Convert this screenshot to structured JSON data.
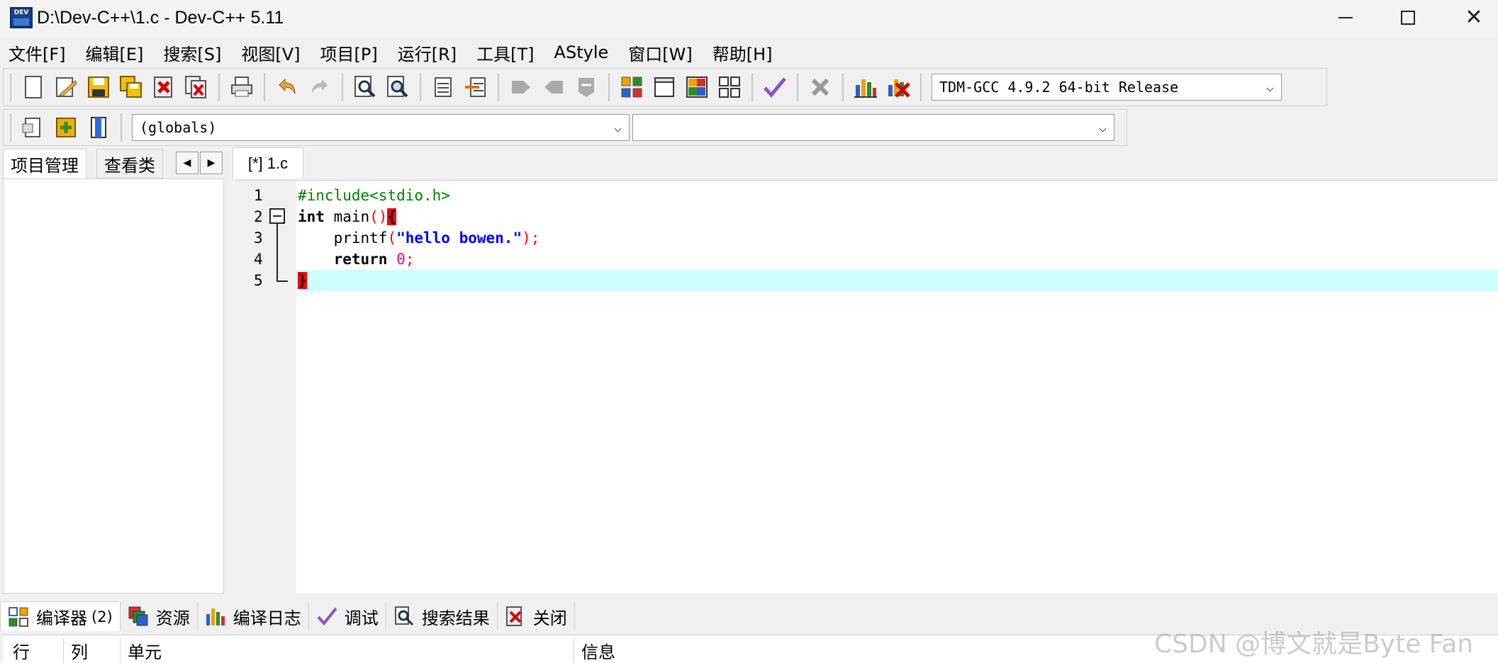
{
  "window": {
    "title": "D:\\Dev-C++\\1.c - Dev-C++ 5.11",
    "icon_label": "DEV",
    "minimize_glyph": "—",
    "close_glyph": "✕"
  },
  "menu": [
    "文件[F]",
    "编辑[E]",
    "搜索[S]",
    "视图[V]",
    "项目[P]",
    "运行[R]",
    "工具[T]",
    "AStyle",
    "窗口[W]",
    "帮助[H]"
  ],
  "toolbar": {
    "compiler_select": "TDM-GCC 4.9.2 64-bit Release",
    "scope_select": "(globals)",
    "symbol_select": ""
  },
  "left_panel": {
    "tabs": [
      "项目管理",
      "查看类"
    ],
    "scroll_left": "◀",
    "scroll_right": "▶"
  },
  "editor": {
    "tab_label": "[*] 1.c",
    "line_numbers": [
      "1",
      "2",
      "3",
      "4",
      "5"
    ],
    "code": {
      "line1": "#include<stdio.h>",
      "line2_kw": "int",
      "line2_fn": " main",
      "line2_paren": "()",
      "line2_brace": "{",
      "line3_fn": "    printf",
      "line3_open": "(",
      "line3_str": "\"hello bowen.\"",
      "line3_close": ");",
      "line4_kw": "    return",
      "line4_num": " 0",
      "line4_semi": ";",
      "line5_brace": "}"
    }
  },
  "bottom_tabs": [
    {
      "label": "编译器",
      "count": "(2)",
      "icon": "compiler-grid-icon"
    },
    {
      "label": "资源",
      "icon": "resources-icon"
    },
    {
      "label": "编译日志",
      "icon": "chart-bars-icon"
    },
    {
      "label": "调试",
      "icon": "check-icon"
    },
    {
      "label": "搜索结果",
      "icon": "search-doc-icon"
    },
    {
      "label": "关闭",
      "icon": "close-red-icon"
    }
  ],
  "messages": {
    "columns": [
      "行",
      "列",
      "单元",
      "信息"
    ]
  },
  "watermark": "CSDN @博文就是Byte Fan",
  "colors": {
    "current_line": "#ccffff",
    "brace_highlight": "#ff0000",
    "preprocessor": "#008000",
    "string": "#0000ff",
    "number": "#ff0080"
  }
}
